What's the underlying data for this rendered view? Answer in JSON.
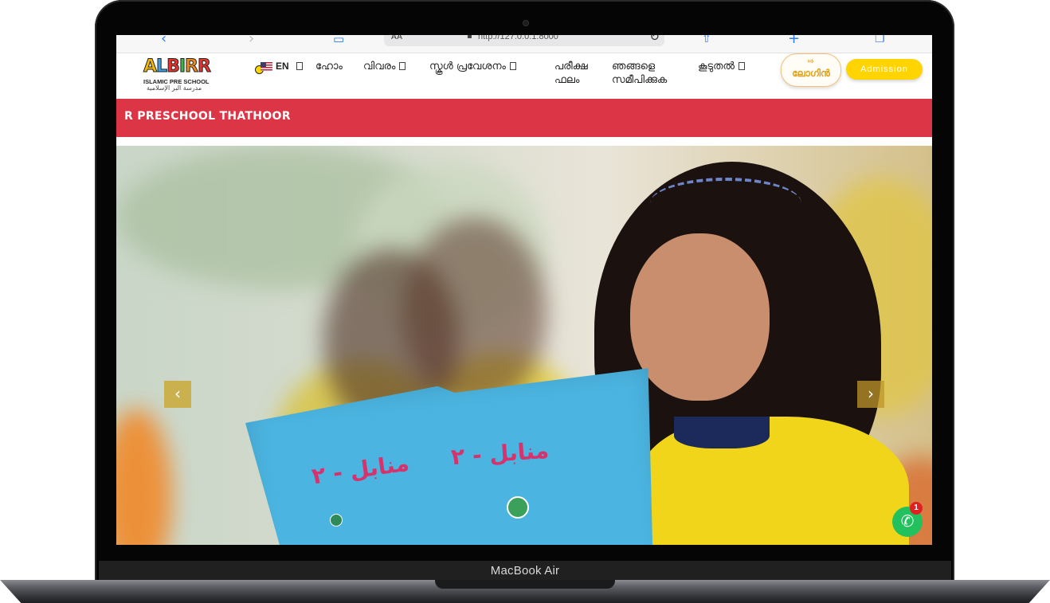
{
  "device": {
    "label": "MacBook Air"
  },
  "browser": {
    "reader_label": "AA",
    "url": "http://127.0.0.1:8000",
    "icons": [
      "chevron-left-icon",
      "chevron-right-icon",
      "book-icon",
      "lock-icon",
      "reload-icon",
      "share-icon",
      "plus-icon",
      "tabs-icon"
    ]
  },
  "header": {
    "logo": {
      "wordmark": [
        "A",
        "L",
        "B",
        "I",
        "R",
        "R"
      ],
      "wordmark_colors": [
        "#f5b800",
        "#3aa0e8",
        "#e8342e",
        "#3cb44a",
        "#f08a1c",
        "#e8342e"
      ],
      "subtitle": "ISLAMIC PRE SCHOOL",
      "arabic": "مدرسة البر الإسلامية"
    },
    "lang": {
      "code": "EN"
    },
    "nav": [
      {
        "label": "ഹോം",
        "dropdown": false
      },
      {
        "label": "വിവരം",
        "dropdown": true
      },
      {
        "label": "സ്കൂൾ പ്രവേശനം",
        "dropdown": true
      },
      {
        "label_line1": "പരീക്ഷ",
        "label_line2": "ഫലം",
        "dropdown": false
      },
      {
        "label_line1": "ഞങ്ങളെ",
        "label_line2": "സമീപിക്കുക",
        "dropdown": false
      },
      {
        "label": "കൂടുതൽ",
        "dropdown": true
      }
    ],
    "login_label": "ലോഗിൻ",
    "admission_label": "Admission",
    "colors": {
      "accent_yellow": "#ffd400",
      "login_text": "#e0a21f"
    }
  },
  "marquee": {
    "text": "R PRESCHOOL THATHOOR",
    "color": "#dc3545"
  },
  "hero": {
    "book_text_1": "منابل - ٢",
    "book_text_2": "منابل - ٢",
    "prev_glyph": "‹",
    "next_glyph": "›"
  },
  "whatsapp": {
    "badge_count": "1",
    "color": "#22c15e"
  }
}
